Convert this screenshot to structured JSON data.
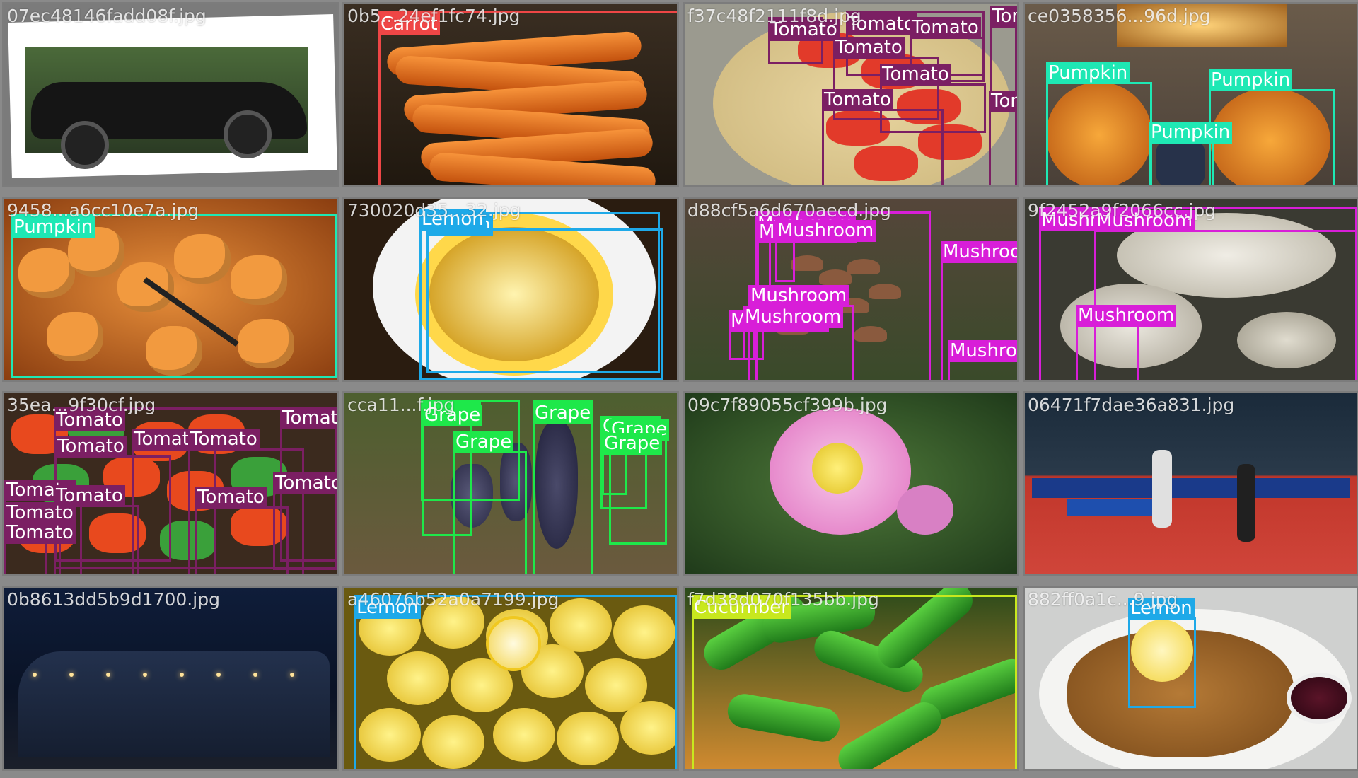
{
  "colors": {
    "Carrot": "#ef4646",
    "Tomato": "#7b1f63",
    "Pumpkin": "#1ee8b4",
    "Lemon": "#1ea9e8",
    "Mushroom": "#d81ed8",
    "Grape": "#1ee84a",
    "Cucumber": "#c8e81e"
  },
  "tiles": [
    {
      "file": "07ec48146fadd08f.jpg",
      "scene": "car",
      "boxes": []
    },
    {
      "file": "0b5...24ef1fc74.jpg",
      "scene": "carrots",
      "boxes": [
        {
          "label": "Carrot"
        }
      ]
    },
    {
      "file": "f37c48f2111f8d.jpg",
      "scene": "tomato-pasta",
      "boxes": [
        {
          "label": "Tomato"
        },
        {
          "label": "Tomato"
        },
        {
          "label": "Tomato"
        },
        {
          "label": "Tomato"
        },
        {
          "label": "Tomato"
        },
        {
          "label": "Tomato"
        },
        {
          "label": "Tomato"
        },
        {
          "label": "Tomato"
        }
      ]
    },
    {
      "file": "ce0358356...96d.jpg",
      "scene": "pumpkins",
      "boxes": [
        {
          "label": "Pumpkin"
        },
        {
          "label": "Pumpkin"
        },
        {
          "label": "Pumpkin"
        }
      ]
    },
    {
      "file": "9458...a6cc10e7a.jpg",
      "scene": "persimmons",
      "boxes": [
        {
          "label": "Pumpkin"
        }
      ]
    },
    {
      "file": "730020d35...32.jpg",
      "scene": "lemon-slice",
      "boxes": [
        {
          "label": "Lemon"
        },
        {
          "label": "Lemon"
        }
      ]
    },
    {
      "file": "d88cf5a6d670aecd.jpg",
      "scene": "small-mushrooms",
      "boxes": [
        {
          "label": "Mushroom"
        },
        {
          "label": "Mushroom"
        },
        {
          "label": "Mushroom"
        },
        {
          "label": "Mushroom"
        },
        {
          "label": "Mushroom"
        },
        {
          "label": "Mushroom"
        },
        {
          "label": "Mushroom"
        },
        {
          "label": "Mushroom"
        }
      ]
    },
    {
      "file": "9f2452a9f2066cc.jpg",
      "scene": "big-mushrooms",
      "boxes": [
        {
          "label": "Mushroom"
        },
        {
          "label": "Mushroom"
        },
        {
          "label": "Mushroom"
        }
      ]
    },
    {
      "file": "35ea...9f30cf.jpg",
      "scene": "tomato-salad",
      "boxes": [
        {
          "label": "Tomato"
        },
        {
          "label": "Tomato"
        },
        {
          "label": "Tomato"
        },
        {
          "label": "Tomato"
        },
        {
          "label": "Tomato"
        },
        {
          "label": "Tomato"
        },
        {
          "label": "Tomato"
        },
        {
          "label": "Tomato"
        },
        {
          "label": "Tomato"
        },
        {
          "label": "Tomato"
        },
        {
          "label": "Tomato"
        }
      ]
    },
    {
      "file": "cca11...f.jpg",
      "scene": "grapes",
      "boxes": [
        {
          "label": "Grape"
        },
        {
          "label": "Grape"
        },
        {
          "label": "Grape"
        },
        {
          "label": "Grape"
        },
        {
          "label": "Grape"
        },
        {
          "label": "Grape"
        },
        {
          "label": "Grape"
        }
      ]
    },
    {
      "file": "09c7f89055cf399b.jpg",
      "scene": "flower",
      "boxes": []
    },
    {
      "file": "06471f7dae36a831.jpg",
      "scene": "table-tennis",
      "boxes": []
    },
    {
      "file": "0b8613dd5b9d1700.jpg",
      "scene": "building-night",
      "boxes": []
    },
    {
      "file": "a46076b52a0a7199.jpg",
      "scene": "lemons",
      "boxes": [
        {
          "label": "Lemon"
        }
      ]
    },
    {
      "file": "f7d38d070f135bb.jpg",
      "scene": "cucumbers",
      "boxes": [
        {
          "label": "Cucumber"
        }
      ]
    },
    {
      "file": "882ff0a1c...9.jpg",
      "scene": "schnitzel",
      "boxes": [
        {
          "label": "Lemon"
        }
      ]
    }
  ]
}
